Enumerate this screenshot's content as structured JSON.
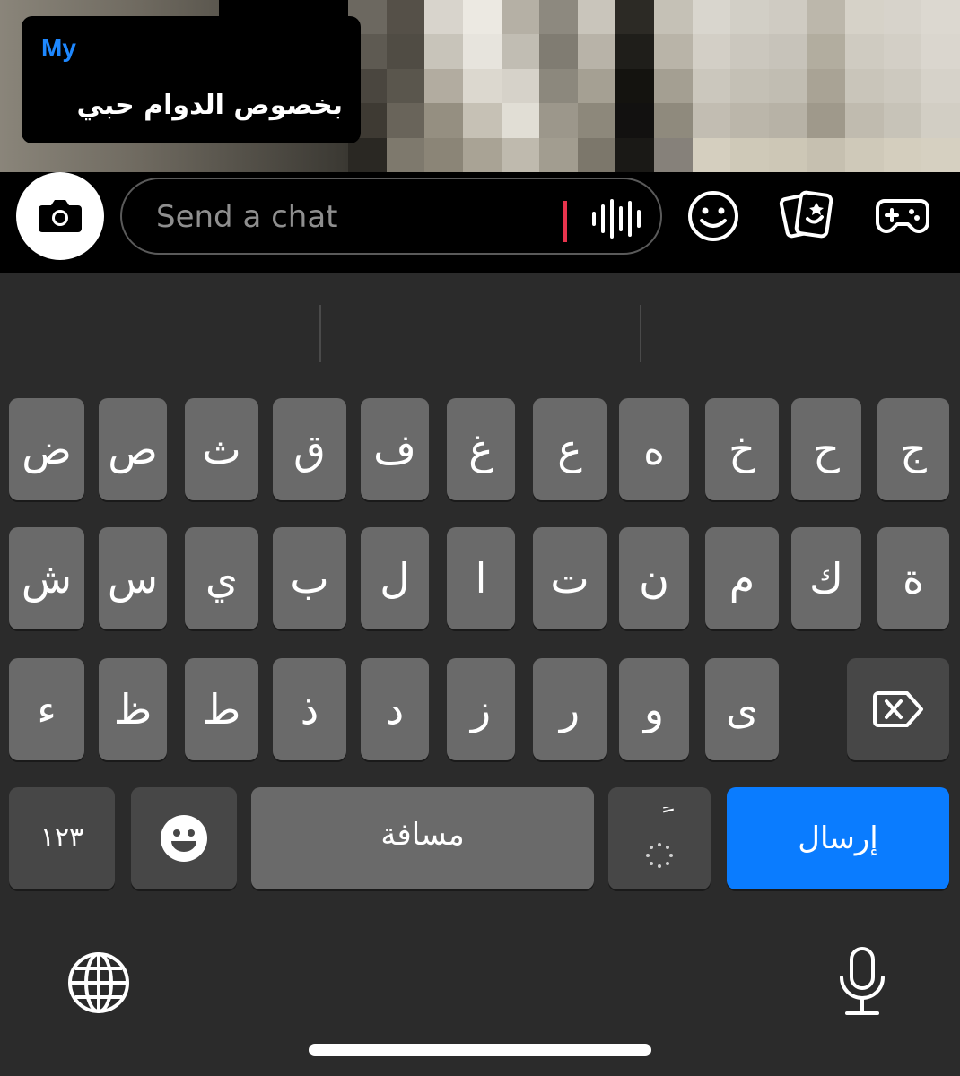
{
  "caption": {
    "sender": "My",
    "text": "بخصوص الدوام حبي"
  },
  "chat_input": {
    "placeholder": "Send a chat"
  },
  "chat_icons": [
    "camera-icon",
    "voice-icon",
    "smiley-icon",
    "stickers-icon",
    "games-icon"
  ],
  "keyboard": {
    "row1": [
      "ض",
      "ص",
      "ث",
      "ق",
      "ف",
      "غ",
      "ع",
      "ه",
      "خ",
      "ح",
      "ج"
    ],
    "row2": [
      "ش",
      "س",
      "ي",
      "ب",
      "ل",
      "ا",
      "ت",
      "ن",
      "م",
      "ك",
      "ة"
    ],
    "row3": [
      "ء",
      "ظ",
      "ط",
      "ذ",
      "د",
      "ز",
      "ر",
      "و",
      "ى"
    ],
    "numbers_label": "١٢٣",
    "space_label": "مسافة",
    "tanween_label": "ً",
    "send_label": "إرسال"
  },
  "colors": {
    "accent_blue": "#0a7cff",
    "sender_blue": "#1e88ff",
    "caret_red": "#e8344d",
    "key_gray": "#6a6a6a",
    "key_dark": "#474747",
    "keyboard_bg": "#2b2b2b"
  }
}
